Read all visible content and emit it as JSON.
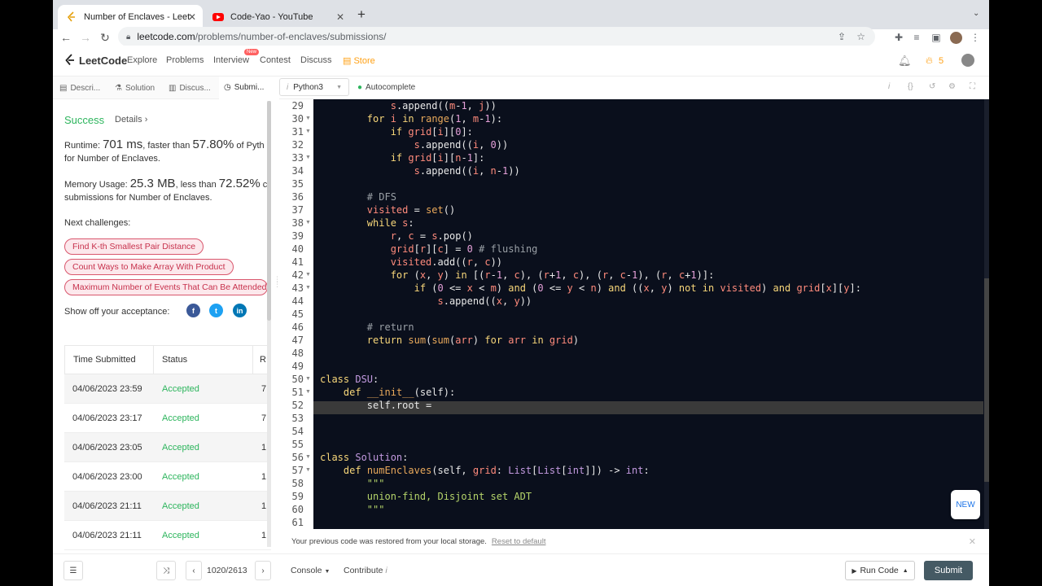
{
  "browser": {
    "tabs": [
      {
        "title": "Number of Enclaves - LeetCode",
        "active": true
      },
      {
        "title": "Code-Yao - YouTube",
        "active": false
      }
    ],
    "url_host": "leetcode.com",
    "url_path": "/problems/number-of-enclaves/submissions/"
  },
  "header": {
    "logo": "LeetCode",
    "nav": [
      "Explore",
      "Problems",
      "Interview",
      "Contest",
      "Discuss",
      "Store"
    ],
    "new_badge": "New",
    "streak": "5"
  },
  "subtabs": [
    "Descri...",
    "Solution",
    "Discus...",
    "Submi..."
  ],
  "result": {
    "status": "Success",
    "details": "Details",
    "runtime_label": "Runtime:",
    "runtime_value": "701 ms",
    "runtime_mid": ", faster than",
    "runtime_pct": "57.80%",
    "runtime_tail": "of Pyth",
    "runtime_line2": "for Number of Enclaves.",
    "memory_label": "Memory Usage:",
    "memory_value": "25.3 MB",
    "memory_mid": ", less than",
    "memory_pct": "72.52%",
    "memory_tail": "c",
    "memory_line2": "submissions for Number of Enclaves.",
    "next_label": "Next challenges:",
    "challenges": [
      "Find K-th Smallest Pair Distance",
      "Count Ways to Make Array With Product",
      "Maximum Number of Events That Can Be Attended"
    ],
    "share_label": "Show off your acceptance:"
  },
  "submissions": {
    "headers": [
      "Time Submitted",
      "Status",
      "R"
    ],
    "rows": [
      {
        "time": "04/06/2023 23:59",
        "status": "Accepted",
        "r": "7"
      },
      {
        "time": "04/06/2023 23:17",
        "status": "Accepted",
        "r": "7"
      },
      {
        "time": "04/06/2023 23:05",
        "status": "Accepted",
        "r": "1"
      },
      {
        "time": "04/06/2023 23:00",
        "status": "Accepted",
        "r": "1"
      },
      {
        "time": "04/06/2023 21:11",
        "status": "Accepted",
        "r": "1"
      },
      {
        "time": "04/06/2023 21:11",
        "status": "Accepted",
        "r": "1"
      }
    ]
  },
  "editor": {
    "language": "Python3",
    "autocomplete": "Autocomplete",
    "line_numbers": [
      "29",
      "30",
      "31",
      "32",
      "33",
      "34",
      "35",
      "36",
      "37",
      "38",
      "39",
      "40",
      "41",
      "42",
      "43",
      "44",
      "45",
      "46",
      "47",
      "48",
      "49",
      "50",
      "51",
      "52",
      "53",
      "54",
      "55",
      "56",
      "57",
      "58",
      "59",
      "60",
      "61"
    ],
    "new_button": "NEW"
  },
  "notice": {
    "text": "Your previous code was restored from your local storage.",
    "reset": "Reset to default"
  },
  "footer": {
    "pagination": "1020/2613",
    "console": "Console",
    "contribute": "Contribute",
    "run": "Run Code",
    "submit": "Submit"
  }
}
